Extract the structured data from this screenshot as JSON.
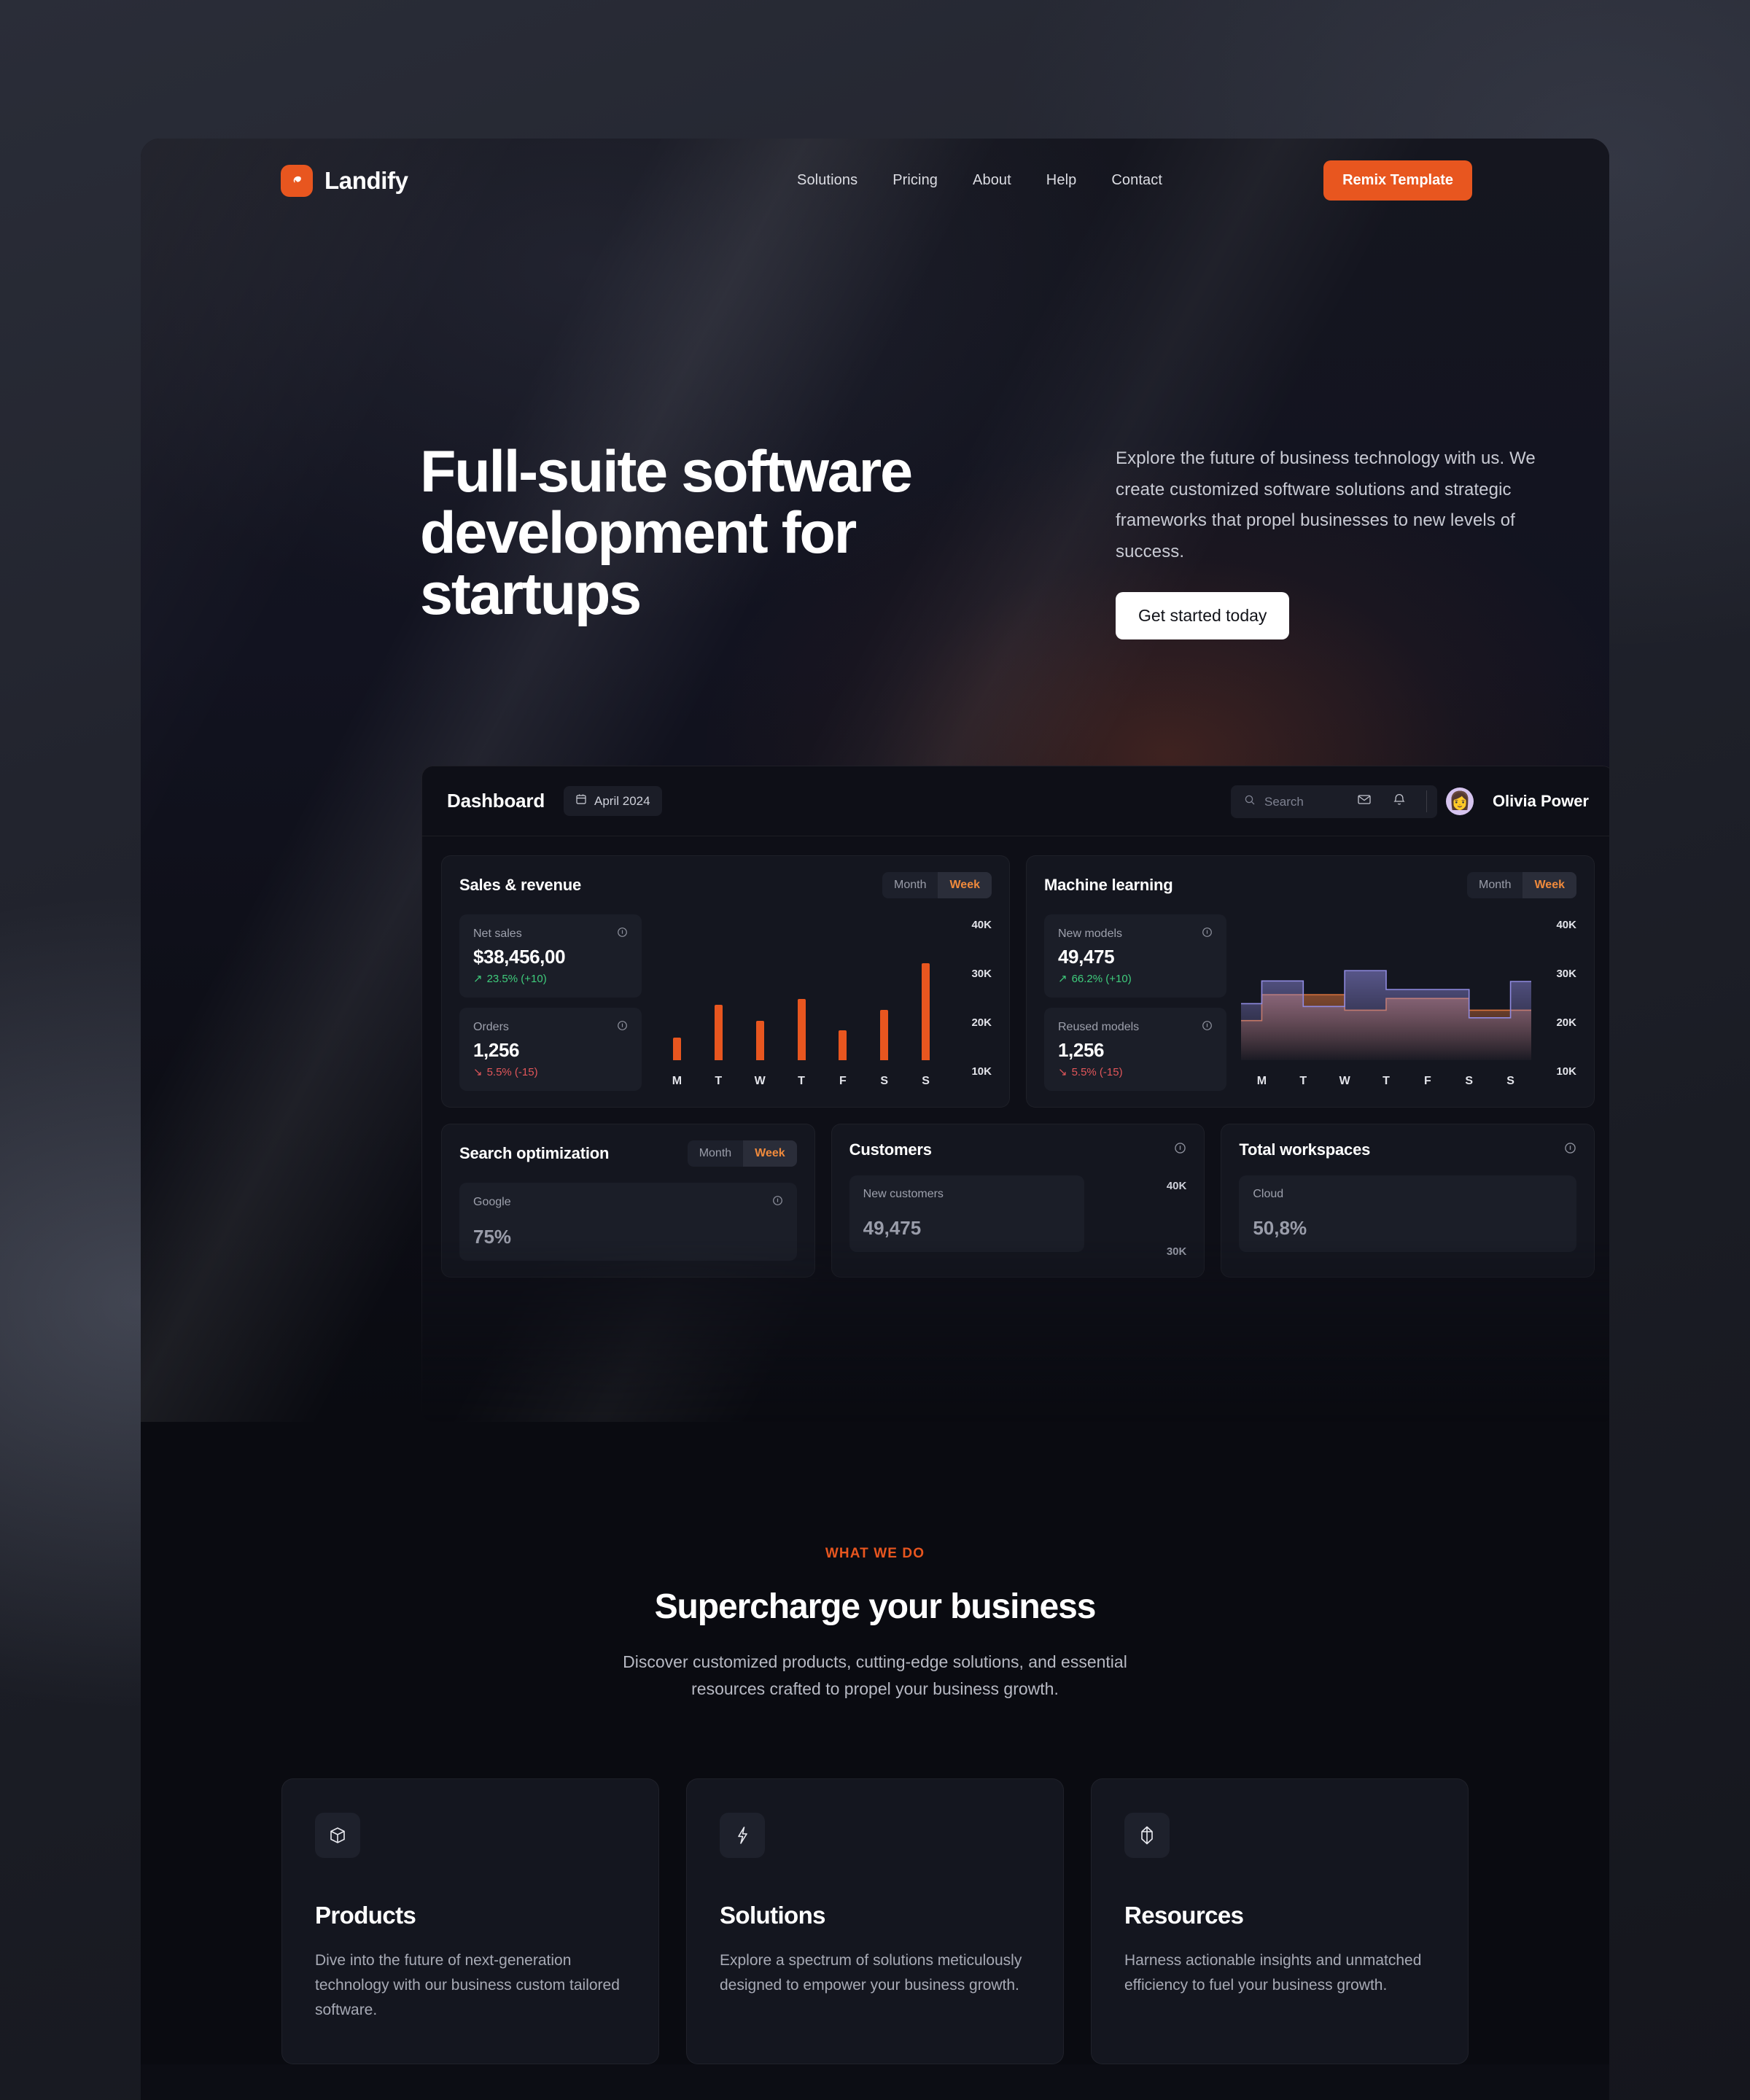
{
  "brand": {
    "name": "Landify",
    "logo_icon": "landify-leaf-logo"
  },
  "nav": {
    "links": [
      "Solutions",
      "Pricing",
      "About",
      "Help",
      "Contact"
    ],
    "cta_label": "Remix Template"
  },
  "hero": {
    "title": "Full-suite software development for startups",
    "paragraph": "Explore the future of business technology with us. We create customized software solutions and strategic frameworks that propel businesses to new levels of success.",
    "cta_label": "Get started today"
  },
  "dashboard": {
    "title": "Dashboard",
    "date": "April 2024",
    "date_icon": "calendar-icon",
    "search_placeholder": "Search",
    "search_icon": "search-icon",
    "mail_icon": "mail-icon",
    "bell_icon": "bell-icon",
    "avatar_icon": "user-avatar",
    "user_name": "Olivia Power",
    "segmented": {
      "month": "Month",
      "week": "Week",
      "active": "Week"
    },
    "cards": {
      "sales": {
        "title": "Sales & revenue",
        "stats": [
          {
            "label": "Net sales",
            "value": "$38,456,00",
            "delta": "23.5% (+10)",
            "direction": "up",
            "info_icon": "info-icon"
          },
          {
            "label": "Orders",
            "value": "1,256",
            "delta": "5.5% (-15)",
            "direction": "down",
            "info_icon": "info-icon"
          }
        ]
      },
      "ml": {
        "title": "Machine learning",
        "stats": [
          {
            "label": "New models",
            "value": "49,475",
            "delta": "66.2% (+10)",
            "direction": "up",
            "info_icon": "info-icon"
          },
          {
            "label": "Reused models",
            "value": "1,256",
            "delta": "5.5% (-15)",
            "direction": "down",
            "info_icon": "info-icon"
          }
        ]
      },
      "seo": {
        "title": "Search optimization",
        "stat_label": "Google",
        "stat_value": "75%",
        "info_icon": "info-icon"
      },
      "customers": {
        "title": "Customers",
        "stat_label": "New customers",
        "stat_value": "49,475",
        "info_icon": "info-icon",
        "y_labels": [
          "40K",
          "30K"
        ]
      },
      "workspaces": {
        "title": "Total workspaces",
        "stat_label": "Cloud",
        "stat_value": "50,8%",
        "info_icon": "info-icon"
      }
    }
  },
  "chart_data": [
    {
      "type": "bar",
      "title": "Sales & revenue",
      "categories": [
        "M",
        "T",
        "W",
        "T",
        "F",
        "S",
        "S"
      ],
      "values": [
        14800,
        21700,
        18400,
        23000,
        16300,
        20700,
        30600
      ],
      "xlabel": "",
      "ylabel": "",
      "ylim": [
        10000,
        40000
      ],
      "ytick_labels": [
        "40K",
        "30K",
        "20K",
        "10K"
      ],
      "grid": false,
      "legend": "none",
      "bar_color": "#e8561f"
    },
    {
      "type": "area",
      "title": "Machine learning",
      "categories": [
        "M",
        "T",
        "W",
        "T",
        "F",
        "S",
        "S"
      ],
      "series": [
        {
          "name": "New models",
          "values": [
            22000,
            26800,
            21400,
            29000,
            25000,
            25000,
            19000,
            26700
          ],
          "color": "#8f8ae0"
        },
        {
          "name": "Reused models",
          "values": [
            18400,
            23900,
            23900,
            20600,
            23100,
            23100,
            20600,
            20600
          ],
          "color": "#d9733c"
        }
      ],
      "ylim": [
        10000,
        40000
      ],
      "ytick_labels": [
        "40K",
        "30K",
        "20K",
        "10K"
      ],
      "grid": false,
      "legend": "none"
    }
  ],
  "what_we_do": {
    "eyebrow": "WHAT WE DO",
    "title": "Supercharge your business",
    "subtitle": "Discover customized products, cutting-edge solutions, and essential resources crafted to propel your business growth.",
    "features": [
      {
        "icon": "cube-wireframe-icon",
        "title": "Products",
        "desc": "Dive into the future of next-generation technology with our business custom tailored software."
      },
      {
        "icon": "lightning-bolt-icon",
        "title": "Solutions",
        "desc": "Explore a spectrum of solutions meticulously designed to empower your business growth."
      },
      {
        "icon": "box-3d-icon",
        "title": "Resources",
        "desc": "Harness actionable insights and unmatched efficiency to fuel your business growth."
      }
    ]
  },
  "colors": {
    "accent": "#e8561f",
    "page_bg": "#0a0b11",
    "card_bg": "#14161f",
    "up": "#3fcc7c",
    "down": "#e2565a"
  }
}
